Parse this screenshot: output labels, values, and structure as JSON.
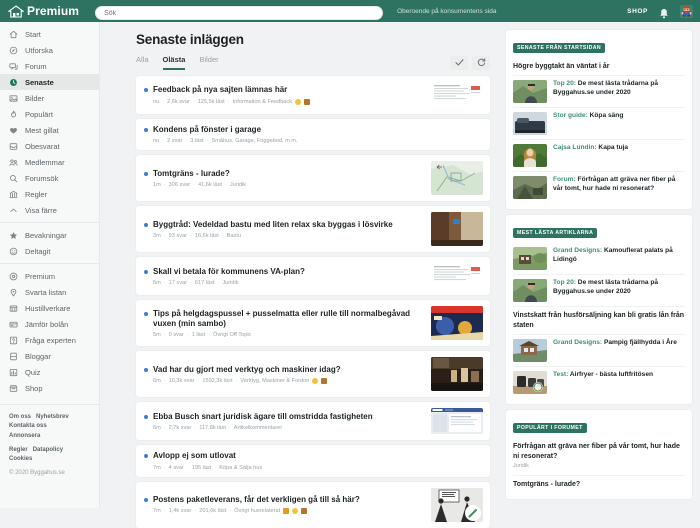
{
  "header": {
    "brand": "Premium",
    "brand_icon": "house-logo-icon",
    "search_placeholder": "Sök",
    "tagline": "Oberoende på konsumentens sida",
    "shop_label": "SHOP",
    "bell_icon": "bell-icon",
    "avatar_icon": "user-avatar"
  },
  "sidebar": {
    "groups": [
      {
        "items": [
          {
            "label": "Start",
            "icon": "home-icon",
            "active": false
          },
          {
            "label": "Utforska",
            "icon": "compass-icon",
            "active": false
          },
          {
            "label": "Forum",
            "icon": "forum-icon",
            "active": false
          },
          {
            "label": "Senaste",
            "icon": "clock-icon",
            "active": true
          },
          {
            "label": "Bilder",
            "icon": "image-icon",
            "active": false
          },
          {
            "label": "Populärt",
            "icon": "fire-icon",
            "active": false
          },
          {
            "label": "Mest gillat",
            "icon": "heart-icon",
            "active": false
          },
          {
            "label": "Obesvarat",
            "icon": "inbox-icon",
            "active": false
          },
          {
            "label": "Medlemmar",
            "icon": "members-icon",
            "active": false
          },
          {
            "label": "Forumsök",
            "icon": "search-icon",
            "active": false
          },
          {
            "label": "Regler",
            "icon": "bank-icon",
            "active": false
          },
          {
            "label": "Visa färre",
            "icon": "chevron-up-icon",
            "active": false
          }
        ]
      },
      {
        "items": [
          {
            "label": "Bevakningar",
            "icon": "star-icon",
            "active": false
          },
          {
            "label": "Deltagit",
            "icon": "smiley-icon",
            "active": false
          }
        ]
      },
      {
        "items": [
          {
            "label": "Premium",
            "icon": "premium-icon",
            "active": false
          },
          {
            "label": "Svarta listan",
            "icon": "pin-icon",
            "active": false
          },
          {
            "label": "Hustillverkare",
            "icon": "building-icon",
            "active": false
          },
          {
            "label": "Jämför bolån",
            "icon": "card-icon",
            "active": false
          },
          {
            "label": "Fråga experten",
            "icon": "question-icon",
            "active": false
          },
          {
            "label": "Bloggar",
            "icon": "blog-icon",
            "active": false
          },
          {
            "label": "Quiz",
            "icon": "chart-icon",
            "active": false
          },
          {
            "label": "Shop",
            "icon": "shop-icon",
            "active": false
          }
        ]
      }
    ],
    "footer": {
      "line1a": "Om oss",
      "line1b": "Nyhetsbrev",
      "line2": "Kontakta oss",
      "line3": "Annonsera",
      "line4a": "Regler",
      "line4b": "Datapolicy",
      "line5": "Cookies",
      "copyright": "© 2020 Byggahus.se"
    }
  },
  "main": {
    "title": "Senaste inläggen",
    "tabs": [
      {
        "label": "Alla",
        "active": false
      },
      {
        "label": "Olästa",
        "active": true
      },
      {
        "label": "Bilder",
        "active": false
      }
    ],
    "actions": [
      {
        "name": "mark-read-button",
        "icon": "check-icon"
      },
      {
        "name": "refresh-button",
        "icon": "refresh-icon"
      }
    ],
    "threads": [
      {
        "title": "Feedback på nya sajten lämnas här",
        "time": "nu",
        "replies": "2,6k svar",
        "views": "125,5k läst",
        "forum": "Information & Feedback",
        "badges": [
          "bi-yellow",
          "bi-brown"
        ],
        "thumb": "document-thumb",
        "thumb_tall": false
      },
      {
        "title": "Kondens på fönster i garage",
        "time": "nu",
        "replies": "2 svar",
        "views": "3 läst",
        "forum": "Småhus, Garage, Friggebod, m.m.",
        "badges": [],
        "thumb": null,
        "thumb_tall": false
      },
      {
        "title": "Tomtgräns - lurade?",
        "time": "1m",
        "replies": "306 svar",
        "views": "41,6k läst",
        "forum": "Juridik",
        "badges": [],
        "thumb": "map-thumb",
        "thumb_tall": true
      },
      {
        "title": "Byggtråd: Vedeldad bastu med liten relax ska byggas i lösvirke",
        "time": "3m",
        "replies": "93 svar",
        "views": "16,6k läst",
        "forum": "Bastu",
        "badges": [],
        "thumb": "sauna-thumb",
        "thumb_tall": true
      },
      {
        "title": "Skall vi betala för kommunens VA-plan?",
        "time": "5m",
        "replies": "17 svar",
        "views": "617 läst",
        "forum": "Juridik",
        "badges": [],
        "thumb": "document-thumb",
        "thumb_tall": false
      },
      {
        "title": "Tips på helgdagspussel + pusselmatta eller rulle till normalbegåvad vuxen (min sambo)",
        "time": "5m",
        "replies": "0 svar",
        "views": "1 läst",
        "forum": "Övrigt Off Topic",
        "badges": [],
        "thumb": "puzzle-thumb",
        "thumb_tall": true
      },
      {
        "title": "Vad har du gjort med verktyg och maskiner idag?",
        "time": "6m",
        "replies": "10,3k svar",
        "views": "1592,3k läst",
        "forum": "Verktyg, Maskiner & Fordon",
        "badges": [
          "bi-yellow",
          "bi-brown"
        ],
        "thumb": "tools-thumb",
        "thumb_tall": true
      },
      {
        "title": "Ebba Busch snart juridisk ägare till omstridda fastigheten",
        "time": "6m",
        "replies": "2,7k svar",
        "views": "117,8k läst",
        "forum": "Artikelkommentarer",
        "badges": [],
        "thumb": "screenshot-thumb",
        "thumb_tall": false
      },
      {
        "title": "Avlopp ej som utlovat",
        "time": "7m",
        "replies": "4 svar",
        "views": "195 läst",
        "forum": "Köpa & Sälja hus",
        "badges": [],
        "thumb": null,
        "thumb_tall": false
      },
      {
        "title": "Postens paketleverans, får det verkligen gå till så här?",
        "time": "7m",
        "replies": "1,4k svar",
        "views": "201,6k läst",
        "forum": "Övrigt husrelaterat",
        "badges": [
          "bi-orange",
          "bi-yellow",
          "bi-brown"
        ],
        "thumb": "comic-thumb",
        "thumb_tall": true
      }
    ]
  },
  "rsidebar": {
    "cards": [
      {
        "tag": "SENASTE FRÅN STARTSIDAN",
        "items": [
          {
            "type": "plain",
            "text": "Högre byggtakt än väntat i år"
          },
          {
            "type": "thumb",
            "pre": "Top 20:",
            "text": " De mest lästa trådarna på Byggahus.se under 2020",
            "thumb": "person-thumb"
          },
          {
            "type": "thumb",
            "pre": "Stor guide:",
            "text": " Köpa säng",
            "thumb": "bed-thumb"
          },
          {
            "type": "thumb",
            "pre": "Cajsa Lundin:",
            "text": " Kapa tuja",
            "thumb": "woman-thumb"
          },
          {
            "type": "thumb",
            "pre": "Forum:",
            "text": " Förfrågan att gräva ner fiber på vår tomt, hur hade ni resonerat?",
            "thumb": "digger-thumb"
          }
        ]
      },
      {
        "tag": "MEST LÄSTA ARTIKLARNA",
        "items": [
          {
            "type": "thumb",
            "pre": "Grand Designs:",
            "text": " Kamouflerat palats på Lidingö",
            "thumb": "house-thumb"
          },
          {
            "type": "thumb",
            "pre": "Top 20:",
            "text": " De mest lästa trådarna på Byggahus.se under 2020",
            "thumb": "person-thumb"
          },
          {
            "type": "plain",
            "text": "Vinstskatt från husförsäljning kan bli gratis lån från staten"
          },
          {
            "type": "thumb",
            "pre": "Grand Designs:",
            "text": " Pampig fjällhydda i Åre",
            "thumb": "cabin-thumb"
          },
          {
            "type": "thumb",
            "pre": "Test:",
            "text": " Airfryer - bästa luftfritösen",
            "thumb": "airfryer-thumb"
          }
        ]
      },
      {
        "tag": "POPULÄRT I FORUMET",
        "items": [
          {
            "type": "plain",
            "text": "Förfrågan att gräva ner fiber på vår tomt, hur hade ni resonerat?",
            "sub": "Juridik"
          },
          {
            "type": "plain",
            "text": "Tomtgräns - lurade?",
            "sub": ""
          }
        ]
      }
    ]
  }
}
